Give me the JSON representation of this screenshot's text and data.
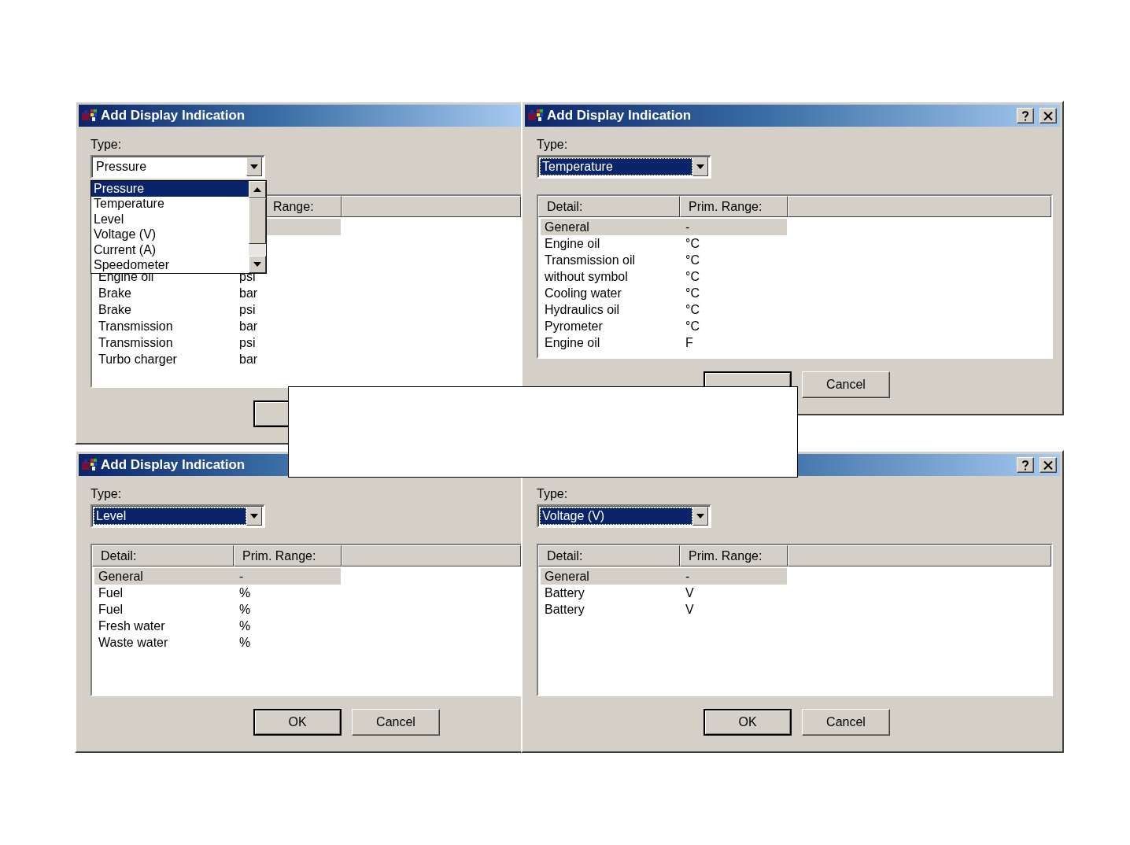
{
  "dialogs": [
    {
      "title": "Add Display Indication",
      "title_buttons": false,
      "type_label": "Type:",
      "type_value": "Pressure",
      "type_highlighted": false,
      "dropdown": [
        {
          "label": "Pressure",
          "selected": true
        },
        {
          "label": "Temperature",
          "selected": false
        },
        {
          "label": "Level",
          "selected": false
        },
        {
          "label": "Voltage (V)",
          "selected": false
        },
        {
          "label": "Current (A)",
          "selected": false
        },
        {
          "label": "Speedometer",
          "selected": false
        }
      ],
      "columns": [
        {},
        {
          "label": "Range:"
        }
      ],
      "rows": [
        {
          "selected": true
        },
        {
          "selected": false
        },
        {
          "selected": false
        },
        {
          "detail": "Engine oil",
          "range": "psi",
          "selected": false
        },
        {
          "detail": "Brake",
          "range": "bar",
          "selected": false
        },
        {
          "detail": "Brake",
          "range": "psi",
          "selected": false
        },
        {
          "detail": "Transmission",
          "range": "bar",
          "selected": false
        },
        {
          "detail": "Transmission",
          "range": "psi",
          "selected": false
        },
        {
          "detail": "Turbo charger",
          "range": "bar",
          "selected": false
        }
      ],
      "buttons": [
        {
          "default": true
        }
      ]
    },
    {
      "title": "Add Display Indication",
      "title_buttons": true,
      "type_label": "Type:",
      "type_value": "Temperature",
      "type_highlighted": true,
      "columns": [
        {
          "label": "Detail:"
        },
        {
          "label": "Prim. Range:"
        }
      ],
      "rows": [
        {
          "detail": "General",
          "range": "-",
          "selected": true
        },
        {
          "detail": "Engine oil",
          "range": "°C",
          "selected": false
        },
        {
          "detail": "Transmission oil",
          "range": "°C",
          "selected": false
        },
        {
          "detail": "without symbol",
          "range": "°C",
          "selected": false
        },
        {
          "detail": "Cooling water",
          "range": "°C",
          "selected": false
        },
        {
          "detail": "Hydraulics oil",
          "range": "°C",
          "selected": false
        },
        {
          "detail": "Pyrometer",
          "range": "°C",
          "selected": false
        },
        {
          "detail": "Engine oil",
          "range": "F",
          "selected": false
        }
      ],
      "buttons": [
        {
          "default": true
        },
        {
          "label": "Cancel",
          "default": false
        }
      ]
    },
    {
      "title": "Add Display Indication",
      "title_buttons": false,
      "type_label": "Type:",
      "type_value": "Level",
      "type_highlighted": true,
      "columns": [
        {
          "label": "Detail:"
        },
        {
          "label": "Prim. Range:"
        }
      ],
      "rows": [
        {
          "detail": "General",
          "range": "-",
          "selected": true
        },
        {
          "detail": "Fuel",
          "range": "%",
          "selected": false
        },
        {
          "detail": "Fuel",
          "range": "%",
          "selected": false
        },
        {
          "detail": "Fresh water",
          "range": "%",
          "selected": false
        },
        {
          "detail": "Waste water",
          "range": "%",
          "selected": false
        }
      ],
      "buttons": [
        {
          "label": "OK",
          "default": true
        },
        {
          "label": "Cancel",
          "default": false
        }
      ]
    },
    {
      "title_buttons": true,
      "type_label": "Type:",
      "type_value": "Voltage (V)",
      "type_highlighted": true,
      "columns": [
        {
          "label": "Detail:"
        },
        {
          "label": "Prim. Range:"
        }
      ],
      "rows": [
        {
          "detail": "General",
          "range": "-",
          "selected": true
        },
        {
          "detail": "Battery",
          "range": "V",
          "selected": false
        },
        {
          "detail": "Battery",
          "range": "V",
          "selected": false
        }
      ],
      "buttons": [
        {
          "label": "OK",
          "default": true
        },
        {
          "label": "Cancel",
          "default": false
        }
      ]
    }
  ]
}
